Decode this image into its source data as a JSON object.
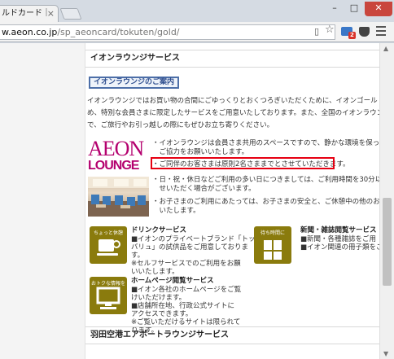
{
  "browser": {
    "tab_title": "ルドカード｜",
    "url_host": "w.aeon.co.jp",
    "url_path": "/sp_aeoncard/tokuten/gold/",
    "window_controls": {
      "minimize": "–",
      "maximize": "□",
      "close": "✕"
    },
    "mail_badge": "2",
    "icons": [
      "page-icon",
      "star-icon",
      "mail-extension-icon",
      "pocket-extension-icon",
      "menu-icon"
    ]
  },
  "page": {
    "section_title": "イオンラウンジサービス",
    "guide_button": "イオンラウンジのご案内",
    "intro_lines": [
      "イオンラウンジではお買い物の合間にごゆっくりとおくつろぎいただくために、イオンゴールドカード会員さ",
      "め、特別な会員さまに限定したサービスをご用意いたしております。また、全国のイオンラウンジでご利",
      "で、ご旅行やお引っ越しの際にもぜひお立ち寄りください。"
    ],
    "logo_top": "AEON",
    "logo_bottom": "LOUNGE",
    "bullets": [
      "・イオンラウンジは会員さま共用のスペースですので、静かな環境を保っていた",
      "　ご協力をお願いいたします。",
      "・ご同伴のお客さまは原則2名さままでとさせていただきます。",
      "・日・祝・休日などご利用の多い日につきましては、ご利用時間を30分以内に",
      "　せいただく場合がございます。",
      "・お子さまのご利用にあたっては、お子さまの安全と、ご休憩中の他のお客さま",
      "　いたします。"
    ],
    "features": [
      {
        "icon_caption": "ちょっと休憩",
        "title": "ドリンクサービス",
        "lines": [
          "■イオンのプライベートブランド「トップ",
          "バリュ」の試供品をご用意しておりま",
          "す。",
          "※セルフサービスでのご利用をお願",
          "いいたします。"
        ]
      },
      {
        "icon_caption": "待ち時間に",
        "title": "新聞・雑誌閲覧サービス",
        "lines": [
          "■新聞・各種雑誌をご用",
          "■イオン関連の冊子類をご"
        ]
      },
      {
        "icon_caption": "おトクな情報を",
        "title": "ホームページ閲覧サービス",
        "lines": [
          "■イオン各社のホームページをご覧",
          "けいただけます。",
          "■店舗所在地、行政公式サイトに",
          "アクセスできます。",
          "※ご覧いただけるサイトは限られて",
          "ります。"
        ]
      }
    ],
    "next_section_title": "羽田空港エアポートラウンジサービス"
  },
  "colors": {
    "brand_magenta": "#b4006e",
    "icon_olive": "#8a7b0d",
    "highlight_red": "#e60012",
    "button_border": "#4d6fa8"
  }
}
